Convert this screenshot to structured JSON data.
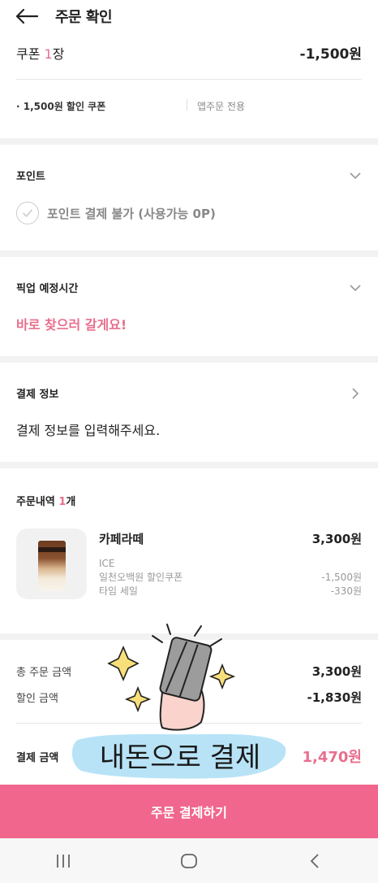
{
  "header": {
    "title": "주문 확인"
  },
  "coupon": {
    "label": "쿠폰",
    "count": "1",
    "unit": "장",
    "amount": "-1,500원",
    "detail_name": "· 1,500원 할인 쿠폰",
    "detail_note": "앱주문 전용"
  },
  "point": {
    "title": "포인트",
    "option": "포인트 결제 불가 (사용가능 0P)"
  },
  "pickup": {
    "title": "픽업 예정시간",
    "value": "바로 찾으러 갈게요!"
  },
  "payment": {
    "title": "결제 정보",
    "value": "결제 정보를 입력해주세요."
  },
  "order": {
    "title": "주문내역",
    "count": "1",
    "unit": "개",
    "item": {
      "name": "카페라떼",
      "price": "3,300원",
      "option": "ICE",
      "discounts": [
        {
          "label": "일천오백원 할인쿠폰",
          "amount": "-1,500원"
        },
        {
          "label": "타임 세일",
          "amount": "-330원"
        }
      ]
    }
  },
  "totals": {
    "total_label": "총 주문 금액",
    "total_value": "3,300원",
    "discount_label": "할인 금액",
    "discount_value": "-1,830원",
    "final_label": "결제 금액",
    "final_value": "1,470원"
  },
  "sticker": {
    "text": "내돈으로 결제"
  },
  "cta": {
    "label": "주문 결제하기"
  },
  "colors": {
    "accent": "#e96f8e",
    "button": "#f0668c",
    "sticker_bg": "#b8e3f7"
  },
  "icons": [
    "back-arrow-icon",
    "chevron-down-icon",
    "chevron-right-icon",
    "check-icon",
    "recent-apps-icon",
    "home-icon",
    "back-nav-icon"
  ]
}
